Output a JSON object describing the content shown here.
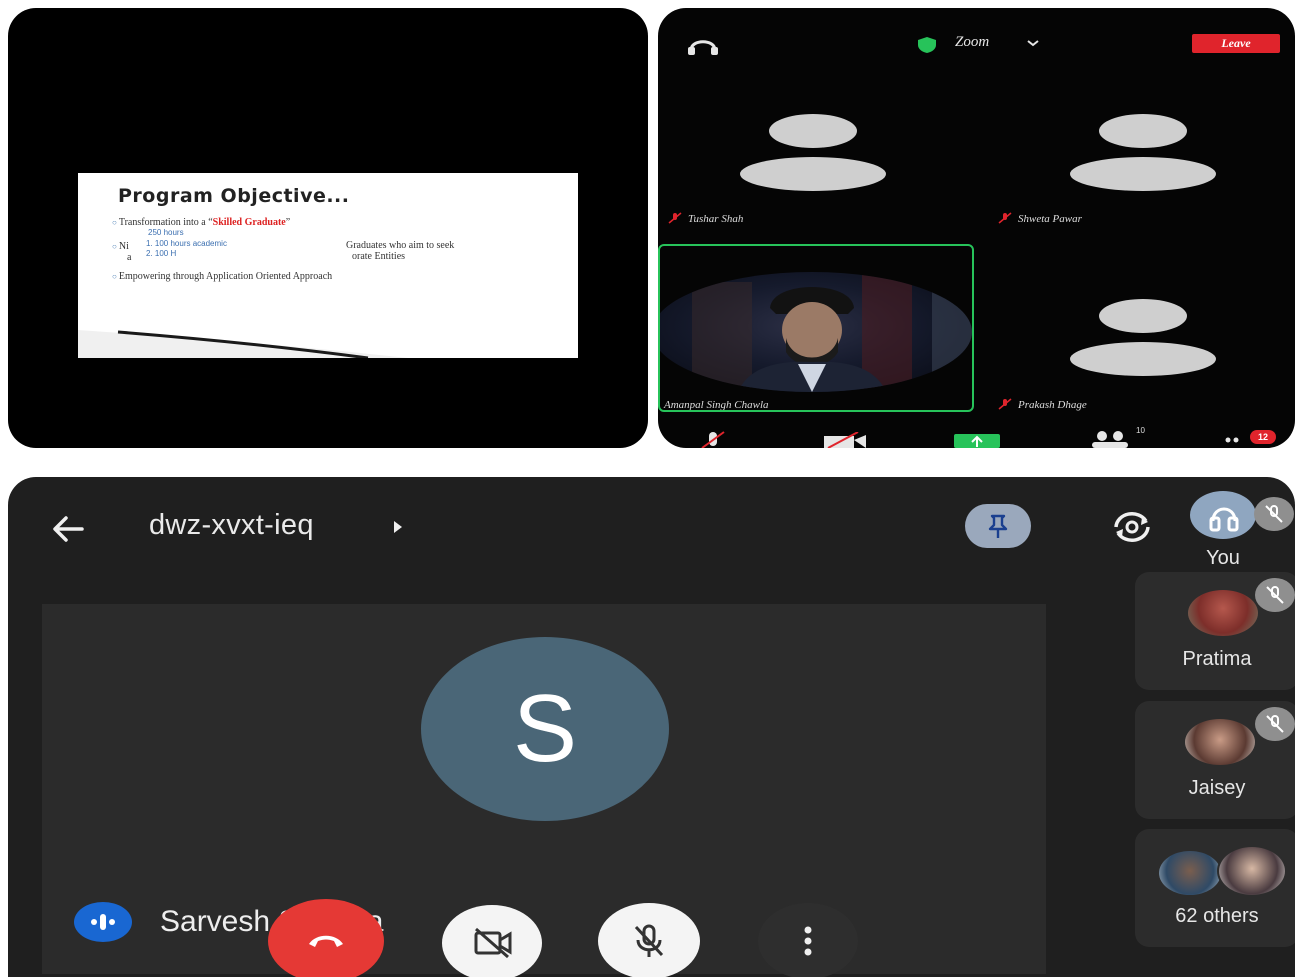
{
  "slide": {
    "title": "Program Objective...",
    "bullet1_prefix": "Transformation into a “",
    "bullet1_highlight": "Skilled Graduate",
    "bullet1_suffix": "”",
    "sub_250": "250 hours",
    "bullet2_start": "Ni",
    "bullet2_a": "a",
    "sub_100_academic": "1. 100 hours academic",
    "sub_100_h": "2. 100 H",
    "bullet2_end1": "Graduates who aim to seek",
    "bullet2_end2": "orate Entities",
    "bullet3": "Empowering through Application Oriented Approach"
  },
  "zoom": {
    "title": "Zoom",
    "leave_label": "Leave",
    "participants": [
      {
        "name": "Tushar Shah"
      },
      {
        "name": "Shweta Pawar"
      },
      {
        "name": "Amanpal Singh Chawla"
      },
      {
        "name": "Prakash Dhage"
      }
    ],
    "participants_count": "10",
    "more_badge": "12",
    "colors": {
      "leave": "#e0242c",
      "active_border": "#27c35a",
      "shield": "#27c35a"
    }
  },
  "meet": {
    "meeting_code": "dwz-xvxt-ieq",
    "main_initial": "S",
    "speaker_name": "Sarvesh Sharma",
    "tiles": [
      {
        "name": "You"
      },
      {
        "name": "Pratima"
      },
      {
        "name": "Jaisey"
      },
      {
        "name": "62 others"
      }
    ],
    "colors": {
      "end_call": "#e53935",
      "initial_bg": "#4a6677",
      "speaking": "#1967d2",
      "pin": "#9aa8bc"
    }
  }
}
